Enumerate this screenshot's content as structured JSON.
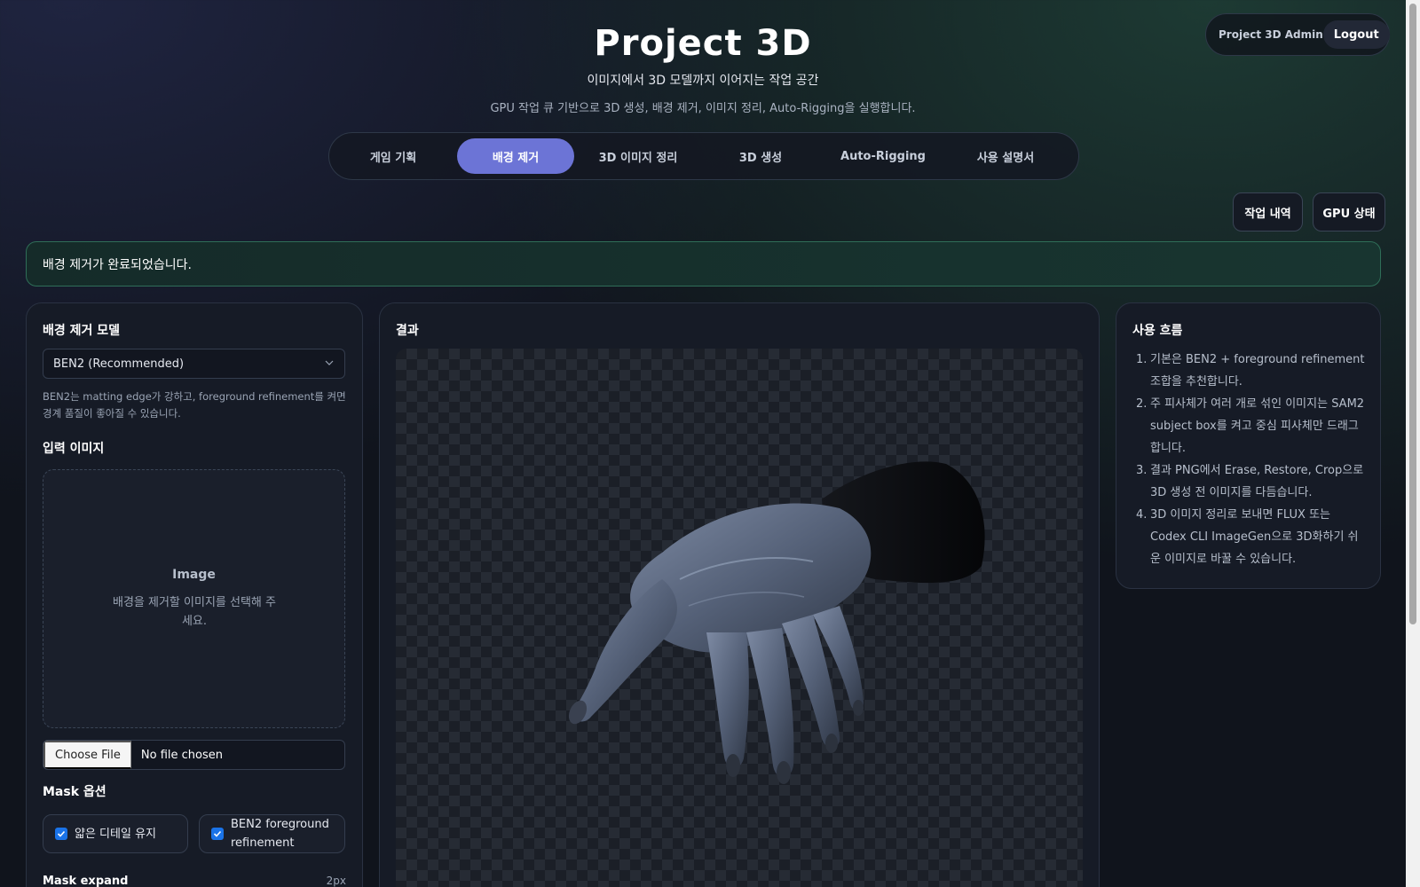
{
  "header": {
    "title": "Project 3D",
    "subtitle": "이미지에서 3D 모델까지 이어지는 작업 공간",
    "description": "GPU 작업 큐 기반으로 3D 생성, 배경 제거, 이미지 정리, Auto-Rigging을 실행합니다."
  },
  "user": {
    "name": "Project 3D Admin",
    "logout_label": "Logout"
  },
  "tabs": [
    {
      "label": "게임 기획",
      "active": false
    },
    {
      "label": "배경 제거",
      "active": true
    },
    {
      "label": "3D 이미지 정리",
      "active": false
    },
    {
      "label": "3D 생성",
      "active": false
    },
    {
      "label": "Auto-Rigging",
      "active": false
    },
    {
      "label": "사용 설명서",
      "active": false
    }
  ],
  "actions": {
    "jobs_label": "작업 내역",
    "gpu_label": "GPU 상태"
  },
  "alert": {
    "message": "배경 제거가 완료되었습니다."
  },
  "left_panel": {
    "model_title": "배경 제거 모델",
    "model_selected": "BEN2 (Recommended)",
    "model_hint": "BEN2는 matting edge가 강하고, foreground refinement를 켜면 경계 품질이 좋아질 수 있습니다.",
    "input_title": "입력 이미지",
    "dropzone_title": "Image",
    "dropzone_text": "배경을 제거할 이미지를 선택해 주세요.",
    "choose_file_label": "Choose File",
    "file_status": "No file chosen",
    "mask_title": "Mask 옵션",
    "checkbox_detail": "얇은 디테일 유지",
    "checkbox_refine": "BEN2 foreground refinement",
    "mask_expand_label": "Mask expand",
    "mask_expand_value": "2px"
  },
  "result_panel": {
    "title": "결과"
  },
  "flow_panel": {
    "title": "사용 흐름",
    "steps": [
      "기본은 BEN2 + foreground refinement 조합을 추천합니다.",
      "주 피사체가 여러 개로 섞인 이미지는 SAM2 subject box를 켜고 중심 피사체만 드래그합니다.",
      "결과 PNG에서 Erase, Restore, Crop으로 3D 생성 전 이미지를 다듬습니다.",
      "3D 이미지 정리로 보내면 FLUX 또는 Codex CLI ImageGen으로 3D화하기 쉬운 이미지로 바꿀 수 있습니다."
    ]
  },
  "colors": {
    "accent": "#6c74d6",
    "success_border": "#2f6e58",
    "checkbox": "#1a73e8",
    "background": "#10141c"
  },
  "icons": {
    "select_chevron": "chevron-down-icon",
    "checkbox_checked": "check-icon",
    "result_image": "hand-icon"
  }
}
